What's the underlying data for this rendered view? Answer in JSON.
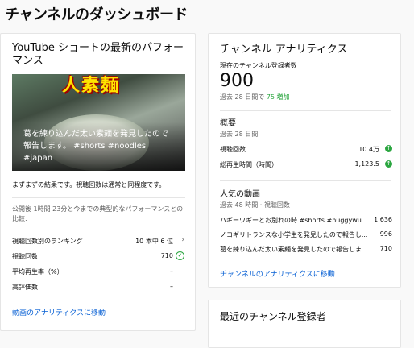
{
  "page": {
    "title": "チャンネルのダッシュボード"
  },
  "left_card": {
    "title": "YouTube ショートの最新のパフォーマンス",
    "thumbnail": {
      "overlay_text": "人素麺",
      "caption": "葛を練り込んだ太い素麺を発見したので報告します。 #shorts #noodles #japan"
    },
    "summary": "まずまずの結果です。視聴回数は通常と同程度です。",
    "comparison": "公開後 1時間 23分と今までの典型的なパフォーマンスとの比較:",
    "rows": [
      {
        "label": "視聴回数別のランキング",
        "value": "10 本中 6 位",
        "icon": "chevron-right-icon",
        "glyph": "›"
      },
      {
        "label": "視聴回数",
        "value": "710",
        "icon": "check-circle-icon",
        "glyph": "✓"
      },
      {
        "label": "平均再生率（%）",
        "value": "–",
        "icon": "",
        "glyph": ""
      },
      {
        "label": "高評価数",
        "value": "–",
        "icon": "",
        "glyph": ""
      }
    ],
    "link": "動画のアナリティクスに移動"
  },
  "right_card": {
    "title": "チャンネル アナリティクス",
    "subs_label": "現在のチャンネル登録者数",
    "subs_value": "900",
    "subs_change_prefix": "過去 28 日間で",
    "subs_change_value": "75 増加",
    "summary": {
      "title": "概要",
      "period": "過去 28 日間",
      "rows": [
        {
          "label": "視聴回数",
          "value": "10.4万"
        },
        {
          "label": "総再生時間（時間）",
          "value": "1,123.5"
        }
      ]
    },
    "top_videos": {
      "title": "人気の動画",
      "period": "過去 48 時間 · 視聴回数",
      "rows": [
        {
          "label": "ハギーワギーとお別れの時 #shorts #huggywugg...",
          "value": "1,636"
        },
        {
          "label": "ノコギリトランスな小学生を発見したので報告し...",
          "value": "996"
        },
        {
          "label": "葛を練り込んだ太い素麺を発見したので報告しま...",
          "value": "710"
        }
      ]
    },
    "link": "チャンネルのアナリティクスに移動"
  },
  "subs_card": {
    "title": "最近のチャンネル登録者"
  },
  "colors": {
    "accent_link": "#065fd4",
    "increase_green": "#2ba640",
    "divider": "#e5e5e5"
  }
}
